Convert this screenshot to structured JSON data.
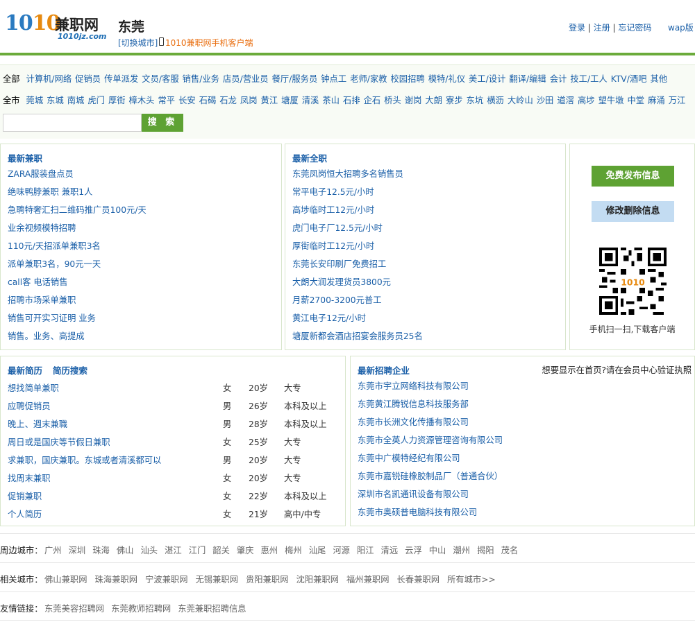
{
  "logo": {
    "num_a": "10",
    "num_b": "10",
    "name": "兼职网",
    "domain": "1010jz.com"
  },
  "header": {
    "city": "东莞",
    "switch_city": "[切换城市]",
    "mobile_client": "1010兼职网手机客户端",
    "login": "登录",
    "register": "注册",
    "forgot": "忘记密码",
    "wap": "wap版",
    "sep": " | "
  },
  "filters": {
    "category_all": "全部",
    "categories": [
      "计算机/网络",
      "促销员",
      "传单派发",
      "文员/客服",
      "销售/业务",
      "店员/营业员",
      "餐厅/服务员",
      "钟点工",
      "老师/家教",
      "校园招聘",
      "模特/礼仪",
      "美工/设计",
      "翻译/编辑",
      "会计",
      "技工/工人",
      "KTV/酒吧",
      "其他"
    ],
    "area_all": "全市",
    "areas": [
      "莞城",
      "东城",
      "南城",
      "虎门",
      "厚街",
      "樟木头",
      "常平",
      "长安",
      "石碣",
      "石龙",
      "凤岗",
      "黄江",
      "塘厦",
      "清溪",
      "茶山",
      "石排",
      "企石",
      "桥头",
      "谢岗",
      "大朗",
      "寮步",
      "东坑",
      "横沥",
      "大岭山",
      "沙田",
      "道滘",
      "高埗",
      "望牛墩",
      "中堂",
      "麻涌",
      "万江"
    ],
    "search_placeholder": "",
    "search_btn": "搜 索"
  },
  "latest_jobs": {
    "title": "最新兼职",
    "items": [
      "ZARA服装盘点员",
      "绝味鸭脖兼职 兼职1人",
      "急聘特奢汇扫二维码推广员100元/天",
      "业余视频模特招聘",
      "110元/天招派单兼职3名",
      "派单兼职3名，90元一天",
      "call客 电话销售",
      "招聘市场采单兼职",
      "销售可开实习证明 业务",
      "销售。业务、高提成"
    ]
  },
  "latest_full": {
    "title": "最新全职",
    "items": [
      "东莞凤岗恒大招聘多名销售员",
      "常平电子12.5元/小时",
      "高埗临时工12元/小时",
      "虎门电子厂12.5元/小时",
      "厚街临时工12元/小时",
      "东莞长安印刷厂免费招工",
      "大朗大润发理货员3800元",
      "月薪2700-3200元普工",
      "黄江电子12元/小时",
      "塘厦新都会酒店招宴会服务员25名"
    ]
  },
  "sidebar": {
    "publish": "免费发布信息",
    "edit": "修改删除信息",
    "qr_caption": "手机扫一扫,下载客户端",
    "qr_badge": "1010"
  },
  "resumes": {
    "title": "最新简历",
    "search_link": "简历搜索",
    "rows": [
      {
        "title": "想找简单兼职",
        "gender": "女",
        "age": "20岁",
        "edu": "大专"
      },
      {
        "title": "应聘促销员",
        "gender": "男",
        "age": "26岁",
        "edu": "本科及以上"
      },
      {
        "title": "晚上、週末兼職",
        "gender": "男",
        "age": "28岁",
        "edu": "本科及以上"
      },
      {
        "title": "周日或是国庆等节假日兼职",
        "gender": "女",
        "age": "25岁",
        "edu": "大专"
      },
      {
        "title": "求兼职，国庆兼职。东城或者清溪都可以",
        "gender": "男",
        "age": "20岁",
        "edu": "大专"
      },
      {
        "title": "找周末兼职",
        "gender": "女",
        "age": "20岁",
        "edu": "大专"
      },
      {
        "title": "促销兼职",
        "gender": "女",
        "age": "22岁",
        "edu": "本科及以上"
      },
      {
        "title": "个人简历",
        "gender": "女",
        "age": "21岁",
        "edu": "高中/中专"
      }
    ]
  },
  "companies": {
    "title": "最新招聘企业",
    "note": "想要显示在首页?请在会员中心验证执照",
    "items": [
      "东莞市宇立网络科技有限公司",
      "东莞黄江腾锐信息科技服务部",
      "东莞市长洲文化传播有限公司",
      "东莞市全英人力资源管理咨询有限公司",
      "东莞中广模特经纪有限公司",
      "东莞市嘉锐硅橡胶制品厂（普通合伙）",
      "深圳市名凯通讯设备有限公司",
      "东莞市奥硕普电脑科技有限公司"
    ]
  },
  "footer": {
    "nearby_label": "周边城市：",
    "nearby": [
      "广州",
      "深圳",
      "珠海",
      "佛山",
      "汕头",
      "湛江",
      "江门",
      "韶关",
      "肇庆",
      "惠州",
      "梅州",
      "汕尾",
      "河源",
      "阳江",
      "清远",
      "云浮",
      "中山",
      "潮州",
      "揭阳",
      "茂名"
    ],
    "related_label": "相关城市：",
    "related": [
      "佛山兼职网",
      "珠海兼职网",
      "宁波兼职网",
      "无锡兼职网",
      "贵阳兼职网",
      "沈阳兼职网",
      "福州兼职网",
      "长春兼职网",
      "所有城市>>"
    ],
    "friends_label": "友情链接：",
    "friends": [
      "东莞美容招聘网",
      "东莞教师招聘网",
      "东莞兼职招聘信息"
    ]
  }
}
